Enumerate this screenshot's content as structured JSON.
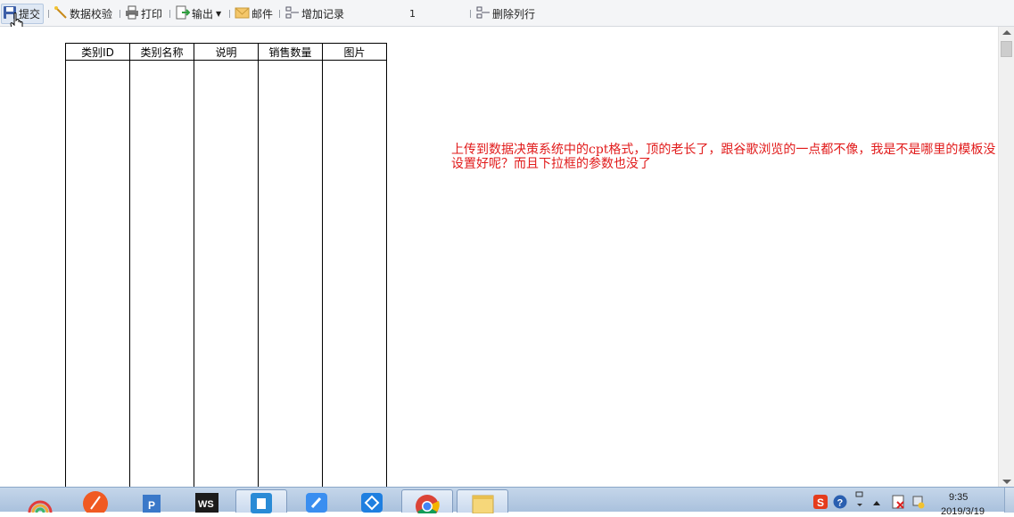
{
  "toolbar": {
    "submit_label": "提交",
    "validate_label": "数据校验",
    "print_label": "打印",
    "export_label": "输出",
    "email_label": "邮件",
    "add_record_label": "增加记录",
    "page_number": "1",
    "delete_row_label": "删除列行"
  },
  "report": {
    "columns": [
      "类别ID",
      "类别名称",
      "说明",
      "销售数量",
      "图片"
    ]
  },
  "note": "上传到数据决策系统中的cpt格式，顶的老长了，跟谷歌浏览的一点都不像，我是不是哪里的模板没设置好呢？而且下拉框的参数也没了",
  "taskbar": {
    "apps": [
      "app-rainbow-icon",
      "app-pen-icon",
      "app-powerpoint-icon",
      "app-webstorm-icon",
      "app-blue-app-icon",
      "app-edit-icon",
      "app-network-icon",
      "app-chrome-icon",
      "app-folder-icon"
    ],
    "tray_ime": "S",
    "clock_time": "9:35",
    "clock_date": "2019/3/19"
  },
  "colors": {
    "note_text": "#e11a1a",
    "toolbar_bg": "#f4f5f7",
    "taskbar_bg": "#b9cde6"
  }
}
